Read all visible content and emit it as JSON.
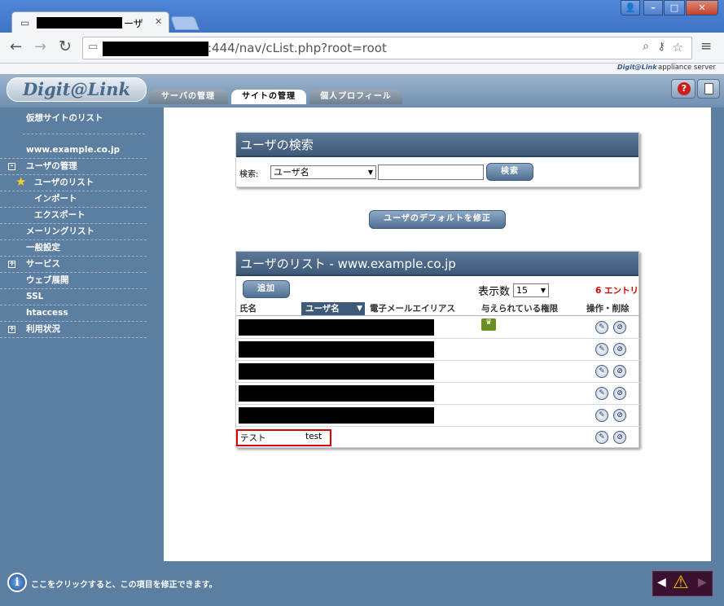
{
  "browser": {
    "tab_title_suffix": "ーザ",
    "url_suffix": ":444/nav/cList.php?root=root",
    "window_buttons": [
      "👤",
      "–",
      "□",
      "✕"
    ]
  },
  "brand": {
    "logo": "Digit@Link",
    "small_logo": "Digit@Link",
    "appliance": "appliance server"
  },
  "header_tabs": [
    {
      "label": "サーバの管理",
      "active": false
    },
    {
      "label": "サイトの管理",
      "active": true
    },
    {
      "label": "個人プロフィール",
      "active": false
    }
  ],
  "sidebar": {
    "items": [
      {
        "label": "仮想サイトのリスト",
        "indent": false,
        "expander": "",
        "star": false
      },
      {
        "label": "www.example.co.jp",
        "indent": false,
        "expander": "",
        "star": false
      },
      {
        "label": "ユーザの管理",
        "indent": false,
        "expander": "-",
        "star": false
      },
      {
        "label": "ユーザのリスト",
        "indent": true,
        "expander": "",
        "star": true
      },
      {
        "label": "インポート",
        "indent": true,
        "expander": "",
        "star": false
      },
      {
        "label": "エクスポート",
        "indent": true,
        "expander": "",
        "star": false
      },
      {
        "label": "メーリングリスト",
        "indent": false,
        "expander": "",
        "star": false
      },
      {
        "label": "一般設定",
        "indent": false,
        "expander": "",
        "star": false
      },
      {
        "label": "サービス",
        "indent": false,
        "expander": "+",
        "star": false
      },
      {
        "label": "ウェブ展開",
        "indent": false,
        "expander": "",
        "star": false
      },
      {
        "label": "SSL",
        "indent": false,
        "expander": "",
        "star": false
      },
      {
        "label": "htaccess",
        "indent": false,
        "expander": "",
        "star": false
      },
      {
        "label": "利用状況",
        "indent": false,
        "expander": "+",
        "star": false
      }
    ]
  },
  "search": {
    "title": "ユーザの検索",
    "label": "検索:",
    "field_selected": "ユーザ名",
    "query": "",
    "button": "検索"
  },
  "defaults_button": "ユーザのデフォルトを修正",
  "user_list": {
    "title": "ユーザのリスト - www.example.co.jp",
    "add_button": "追加",
    "per_page_label": "表示数",
    "per_page": "15",
    "entry_count": "6 エントリ",
    "columns": [
      "氏名",
      "ユーザ名",
      "電子メールエイリアス",
      "与えられている権限",
      "操作・削除"
    ],
    "sort_indicator": "▼",
    "rows": [
      {
        "fullname": "",
        "username": "",
        "redacted": true,
        "admin": true
      },
      {
        "fullname": "",
        "username": "",
        "redacted": true,
        "admin": false
      },
      {
        "fullname": "",
        "username": "",
        "redacted": true,
        "admin": false
      },
      {
        "fullname": "",
        "username": "",
        "redacted": true,
        "admin": false
      },
      {
        "fullname": "",
        "username": "",
        "redacted": true,
        "admin": false
      },
      {
        "fullname": "テスト",
        "username": "test",
        "redacted": false,
        "admin": false,
        "highlighted": true
      }
    ]
  },
  "footer": {
    "info_text": "ここをクリックすると、この項目を修正できます。"
  },
  "colors": {
    "background": "#5b7ea1",
    "entry_count": "#cc0000",
    "highlight_border": "#e00000"
  }
}
